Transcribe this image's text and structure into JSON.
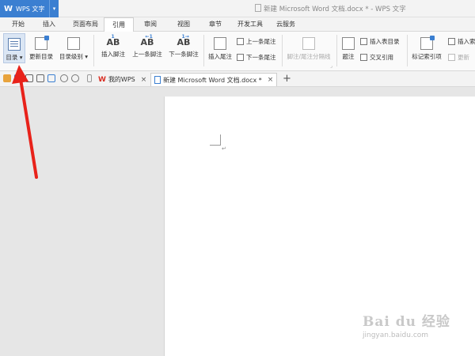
{
  "app": {
    "name": "WPS 文字",
    "logo": "W"
  },
  "window": {
    "title": "新建 Microsoft Word 文档.docx * - WPS 文字"
  },
  "menu_tabs": [
    "开始",
    "插入",
    "页面布局",
    "引用",
    "审阅",
    "视图",
    "章节",
    "开发工具",
    "云服务"
  ],
  "active_menu_tab": "引用",
  "ribbon": {
    "toc": "目录",
    "update_toc": "更新目录",
    "toc_level": "目录级别",
    "insert_footnote": "插入脚注",
    "prev_footnote": "上一条脚注",
    "next_footnote": "下一条脚注",
    "insert_endnote": "插入尾注",
    "prev_endnote": "上一条尾注",
    "next_endnote": "下一条尾注",
    "footnote_separator": "脚注/尾注分隔线",
    "caption": "题注",
    "insert_table_of_figures": "插入表目录",
    "cross_reference": "交叉引用",
    "mark_index_entry": "标记索引项",
    "insert_index": "插入索",
    "update_index": "更新"
  },
  "doc_tabs": [
    {
      "label": "我的WPS",
      "close": "×"
    },
    {
      "label": "新建 Microsoft Word 文档.docx *",
      "close": "×"
    }
  ],
  "new_tab": "+",
  "watermark": {
    "main": "Bai du 经验",
    "sub": "jingyan.baidu.com"
  },
  "colors": {
    "accent": "#3b7fd1",
    "arrow": "#e8221a",
    "wps_red": "#d93025"
  }
}
